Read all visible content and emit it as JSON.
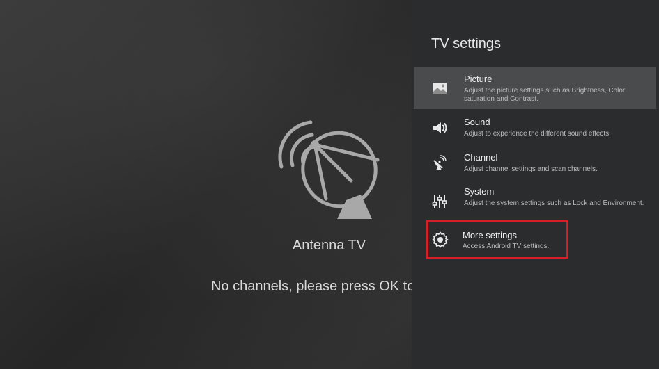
{
  "tv_screen": {
    "input_name": "Antenna TV",
    "message": "No channels, please press OK to",
    "icon": "satellite-dish-icon"
  },
  "panel": {
    "title": "TV settings",
    "items": [
      {
        "label": "Picture",
        "description": "Adjust the picture settings such as Brightness, Color saturation and Contrast.",
        "icon": "picture-icon",
        "selected": true
      },
      {
        "label": "Sound",
        "description": "Adjust to experience the different sound effects.",
        "icon": "speaker-icon",
        "selected": false
      },
      {
        "label": "Channel",
        "description": "Adjust channel settings and scan channels.",
        "icon": "satellite-dish-icon",
        "selected": false
      },
      {
        "label": "System",
        "description": "Adjust the system settings such as Lock and Environment.",
        "icon": "sliders-icon",
        "selected": false
      },
      {
        "label": "More settings",
        "description": "Access Android TV settings.",
        "icon": "gear-icon",
        "selected": false
      }
    ]
  },
  "colors": {
    "highlight": "#d61f26",
    "panel_bg": "#2b2c2e",
    "selected_bg": "#4a4b4d"
  }
}
